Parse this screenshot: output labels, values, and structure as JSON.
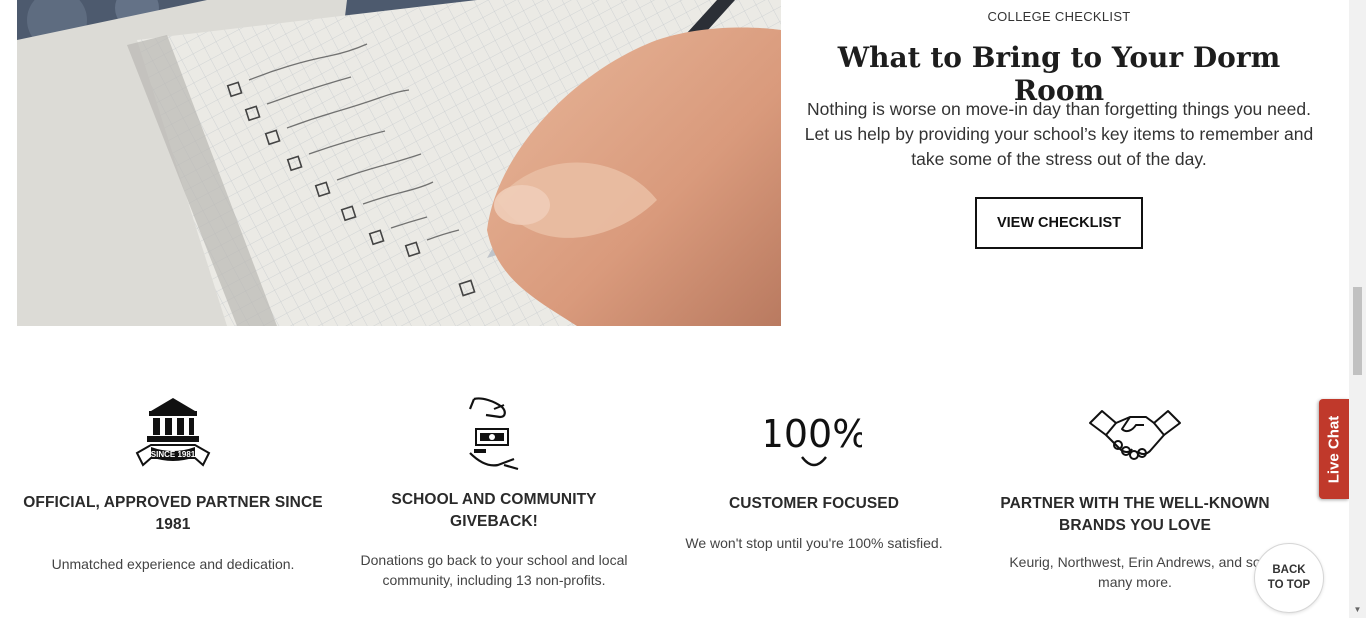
{
  "promo": {
    "eyebrow": "COLLEGE CHECKLIST",
    "title": "What to Bring to Your Dorm Room",
    "body": "Nothing is worse on move-in day than forgetting things you need. Let us help by providing your school’s key items to remember and take some of the stress out of the day.",
    "button_label": "VIEW CHECKLIST"
  },
  "features": [
    {
      "icon": "institution-icon",
      "badge": "SINCE 1981",
      "title": "OFFICIAL, APPROVED PARTNER SINCE 1981",
      "text": "Unmatched experience and dedication."
    },
    {
      "icon": "donation-hands-icon",
      "title": "SCHOOL AND COMMUNITY GIVEBACK!",
      "text": "Donations go back to your school and local community, including 13 non-profits."
    },
    {
      "icon": "hundred-percent-smile-icon",
      "badge": "100%",
      "title": "CUSTOMER FOCUSED",
      "text": "We won't stop until you're 100% satisfied."
    },
    {
      "icon": "handshake-icon",
      "title": "PARTNER WITH THE WELL-KNOWN BRANDS YOU LOVE",
      "text": "Keurig, Northwest, Erin Andrews, and so many more."
    }
  ],
  "widgets": {
    "live_chat": "Live Chat",
    "back_to_top": "BACK TO TOP"
  },
  "colors": {
    "live_chat_bg": "#c0392b",
    "button_border": "#111111"
  }
}
